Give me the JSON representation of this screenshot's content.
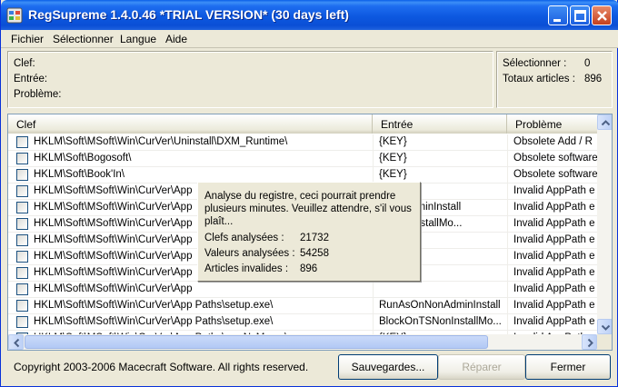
{
  "window": {
    "title": "RegSupreme 1.4.0.46  *TRIAL VERSION* (30 days left)"
  },
  "menu": [
    "Fichier",
    "Sélectionner",
    "Langue",
    "Aide"
  ],
  "info": {
    "key_label": "Clef:",
    "entry_label": "Entrée:",
    "problem_label": "Problème:",
    "selected_label": "Sélectionner :",
    "selected_value": "0",
    "total_label": "Totaux articles :",
    "total_value": "896"
  },
  "columns": [
    "Clef",
    "Entrée",
    "Problème"
  ],
  "rows": [
    {
      "key": "HKLM\\Soft\\MSoft\\Win\\CurVer\\Uninstall\\DXM_Runtime\\",
      "entry": "{KEY}",
      "problem": "Obsolete Add / R"
    },
    {
      "key": "HKLM\\Soft\\Bogosoft\\",
      "entry": "{KEY}",
      "problem": "Obsolete software"
    },
    {
      "key": "HKLM\\Soft\\Book'In\\",
      "entry": "{KEY}",
      "problem": "Obsolete software"
    },
    {
      "key": "HKLM\\Soft\\MSoft\\Win\\CurVer\\App",
      "entry": "",
      "problem": "Invalid AppPath e"
    },
    {
      "key": "HKLM\\Soft\\MSoft\\Win\\CurVer\\App",
      "entry": "nNonAdminInstall",
      "problem": "Invalid AppPath e"
    },
    {
      "key": "HKLM\\Soft\\MSoft\\Win\\CurVer\\App",
      "entry": "TSNonInstallMo...",
      "problem": "Invalid AppPath e"
    },
    {
      "key": "HKLM\\Soft\\MSoft\\Win\\CurVer\\App",
      "entry": "",
      "problem": "Invalid AppPath e"
    },
    {
      "key": "HKLM\\Soft\\MSoft\\Win\\CurVer\\App",
      "entry": "",
      "problem": "Invalid AppPath e"
    },
    {
      "key": "HKLM\\Soft\\MSoft\\Win\\CurVer\\App",
      "entry": "",
      "problem": "Invalid AppPath e"
    },
    {
      "key": "HKLM\\Soft\\MSoft\\Win\\CurVer\\App",
      "entry": "",
      "problem": "Invalid AppPath e"
    },
    {
      "key": "HKLM\\Soft\\MSoft\\Win\\CurVer\\App Paths\\setup.exe\\",
      "entry": "RunAsOnNonAdminInstall",
      "problem": "Invalid AppPath e"
    },
    {
      "key": "HKLM\\Soft\\MSoft\\Win\\CurVer\\App Paths\\setup.exe\\",
      "entry": "BlockOnTSNonInstallMo...",
      "problem": "Invalid AppPath e"
    },
    {
      "key": "HKLM\\Soft\\MSoft\\Win\\CurVer\\App Paths\\sweNyM.exe\\",
      "entry": "{KEY}",
      "problem": "Invalid AppPath e"
    }
  ],
  "popup": {
    "message_line1": "Analyse du registre, ceci pourrait prendre",
    "message_line2": "plusieurs minutes. Veuillez attendre, s'il vous",
    "message_line3": "plaît...",
    "keys_label": "Clefs analysées :",
    "keys_value": "21732",
    "values_label": "Valeurs analysées :",
    "values_value": "54258",
    "invalid_label": "Articles invalides :",
    "invalid_value": "896"
  },
  "footer": {
    "copyright": "Copyright 2003-2006 Macecraft Software. All rights reserved.",
    "backups_button": "Sauvegardes...",
    "repair_button": "Réparer",
    "close_button": "Fermer"
  }
}
